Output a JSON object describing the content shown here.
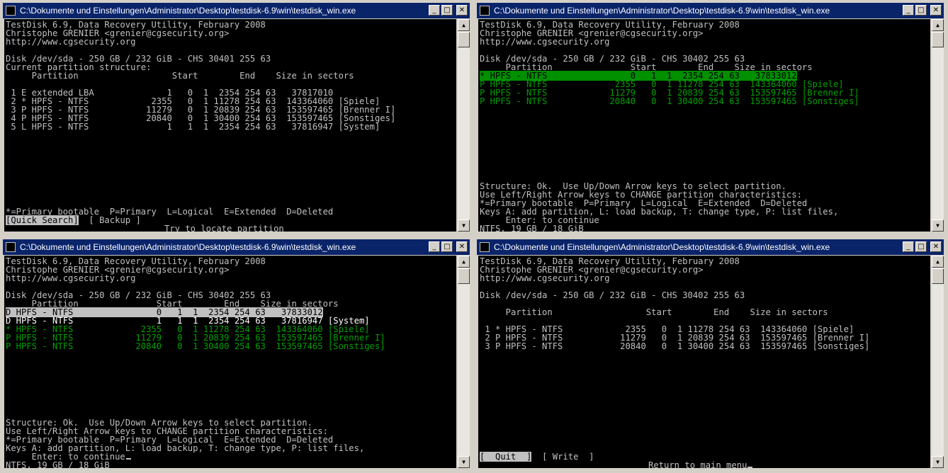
{
  "windows": [
    {
      "title": "C:\\Dokumente und Einstellungen\\Administrator\\Desktop\\testdisk-6.9\\win\\testdisk_win.exe",
      "header": [
        "TestDisk 6.9, Data Recovery Utility, February 2008",
        "Christophe GRENIER <grenier@cgsecurity.org>",
        "http://www.cgsecurity.org"
      ],
      "disk": "Disk /dev/sda - 250 GB / 232 GiB - CHS 30401 255 63",
      "subtitle": "Current partition structure:",
      "col_header": "     Partition                  Start        End    Size in sectors",
      "rows": [
        " 1 E extended LBA              1   0  1  2354 254 63   37817010",
        " 2 * HPFS - NTFS            2355   0  1 11278 254 63  143364060 [Spiele]",
        " 3 P HPFS - NTFS           11279   0  1 20839 254 63  153597465 [Brenner I]",
        " 4 P HPFS - NTFS           20840   0  1 30400 254 63  153597465 [Sonstiges]",
        " 5 L HPFS - NTFS               1   1  1  2354 254 63   37816947 [System]"
      ],
      "legend": "*=Primary bootable  P=Primary  L=Logical  E=Extended  D=Deleted",
      "btn_quick_search": "[Quick Search]",
      "btn_backup": "[ Backup ]",
      "hint": "Try to locate partition"
    },
    {
      "title": "C:\\Dokumente und Einstellungen\\Administrator\\Desktop\\testdisk-6.9\\win\\testdisk_win.exe",
      "header": [
        "TestDisk 6.9, Data Recovery Utility, February 2008",
        "Christophe GRENIER <grenier@cgsecurity.org>",
        "http://www.cgsecurity.org"
      ],
      "disk": "Disk /dev/sda - 250 GB / 232 GiB - CHS 30402 255 63",
      "col_header": "     Partition               Start        End    Size in sectors",
      "rows": [
        "* HPFS - NTFS                0   1  1  2354 254 63   37833012",
        "P HPFS - NTFS             2355   0  1 11278 254 63  143364060 [Spiele]",
        "P HPFS - NTFS            11279   0  1 20839 254 63  153597465 [Brenner I]",
        "P HPFS - NTFS            20840   0  1 30400 254 63  153597465 [Sonstiges]"
      ],
      "footer": [
        "Structure: Ok.  Use Up/Down Arrow keys to select partition.",
        "Use Left/Right Arrow keys to CHANGE partition characteristics:",
        "*=Primary bootable  P=Primary  L=Logical  E=Extended  D=Deleted",
        "Keys A: add partition, L: load backup, T: change type, P: list files,",
        "     Enter: to continue",
        "NTFS, 19 GB / 18 GiB"
      ]
    },
    {
      "title": "C:\\Dokumente und Einstellungen\\Administrator\\Desktop\\testdisk-6.9\\win\\testdisk_win.exe",
      "header": [
        "TestDisk 6.9, Data Recovery Utility, February 2008",
        "Christophe GRENIER <grenier@cgsecurity.org>",
        "http://www.cgsecurity.org"
      ],
      "disk": "Disk /dev/sda - 250 GB / 232 GiB - CHS 30402 255 63",
      "col_header": "     Partition               Start        End    Size in sectors",
      "rows": [
        "D HPFS - NTFS                0   1  1  2354 254 63   37833012",
        "D HPFS - NTFS                1   1  1  2354 254 63   37816947 [System]",
        "* HPFS - NTFS             2355   0  1 11278 254 63  143364060 [Spiele]",
        "P HPFS - NTFS            11279   0  1 20839 254 63  153597465 [Brenner I]",
        "P HPFS - NTFS            20840   0  1 30400 254 63  153597465 [Sonstiges]"
      ],
      "footer": [
        "Structure: Ok.  Use Up/Down Arrow keys to select partition.",
        "Use Left/Right Arrow keys to CHANGE partition characteristics:",
        "*=Primary bootable  P=Primary  L=Logical  E=Extended  D=Deleted",
        "Keys A: add partition, L: load backup, T: change type, P: list files,",
        "     Enter: to continue",
        "NTFS, 19 GB / 18 GiB"
      ]
    },
    {
      "title": "C:\\Dokumente und Einstellungen\\Administrator\\Desktop\\testdisk-6.9\\win\\testdisk_win.exe",
      "header": [
        "TestDisk 6.9, Data Recovery Utility, February 2008",
        "Christophe GRENIER <grenier@cgsecurity.org>",
        "http://www.cgsecurity.org"
      ],
      "disk": "Disk /dev/sda - 250 GB / 232 GiB - CHS 30402 255 63",
      "col_header": "     Partition                  Start        End    Size in sectors",
      "rows": [
        " 1 * HPFS - NTFS            2355   0  1 11278 254 63  143364060 [Spiele]",
        " 2 P HPFS - NTFS           11279   0  1 20839 254 63  153597465 [Brenner I]",
        " 3 P HPFS - NTFS           20840   0  1 30400 254 63  153597465 [Sonstiges]"
      ],
      "btn_quit": "[  Quit  ]",
      "btn_write": "[ Write  ]",
      "hint": "Return to main menu"
    }
  ]
}
